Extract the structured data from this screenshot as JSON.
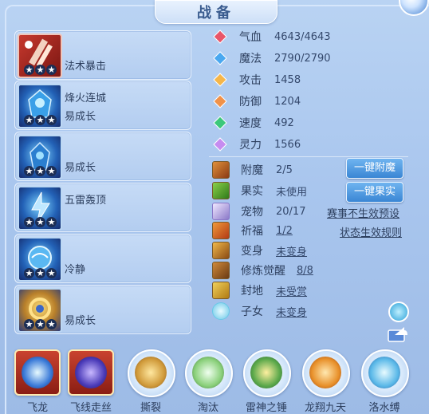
{
  "title": "战备",
  "equipment": [
    {
      "label": "法术暴击",
      "stars": "★★★",
      "theme": "red"
    },
    {
      "label": "烽火连城",
      "sub": "易成长",
      "stars": "★★★",
      "theme": "blue"
    },
    {
      "label": "易成长",
      "stars": "★★★",
      "theme": "blue"
    },
    {
      "label": "五雷轰顶",
      "stars": "★★★",
      "theme": "blue"
    },
    {
      "label": "冷静",
      "stars": "★★★",
      "theme": "blue"
    },
    {
      "label": "易成长",
      "stars": "★★★",
      "theme": "gold"
    }
  ],
  "stats": [
    {
      "name": "气血",
      "value": "4643/4643",
      "color": "#e8566a"
    },
    {
      "name": "魔法",
      "value": "2790/2790",
      "color": "#4aa8f0"
    },
    {
      "name": "攻击",
      "value": "1458",
      "color": "#f5b64a"
    },
    {
      "name": "防御",
      "value": "1204",
      "color": "#f0924a"
    },
    {
      "name": "速度",
      "value": "492",
      "color": "#3cc87a"
    },
    {
      "name": "灵力",
      "value": "1566",
      "color": "#c68cf0"
    }
  ],
  "attrs": {
    "enchant": {
      "name": "附魔",
      "value": "2/5"
    },
    "fruit": {
      "name": "果实",
      "value": "未使用"
    },
    "pet": {
      "name": "宠物",
      "value": "20/17"
    },
    "bless": {
      "name": "祈福",
      "value": "1/2"
    },
    "transform": {
      "name": "变身",
      "value": "未变身"
    },
    "cultivate": {
      "name": "修炼觉醒",
      "value": "8/8"
    },
    "fief": {
      "name": "封地",
      "value": "未受赏"
    },
    "child": {
      "name": "子女",
      "value": "未变身"
    }
  },
  "buttons": {
    "enchant": "一键附魔",
    "fruit": "一键果实"
  },
  "links": {
    "preset": "赛事不生效预设",
    "rules": "状态生效规则"
  },
  "skills": [
    {
      "label": "飞龙"
    },
    {
      "label": "飞线走丝"
    },
    {
      "label": "撕裂"
    },
    {
      "label": "淘汰"
    },
    {
      "label": "雷神之锤"
    },
    {
      "label": "龙翔九天"
    },
    {
      "label": "洛水缚"
    }
  ]
}
